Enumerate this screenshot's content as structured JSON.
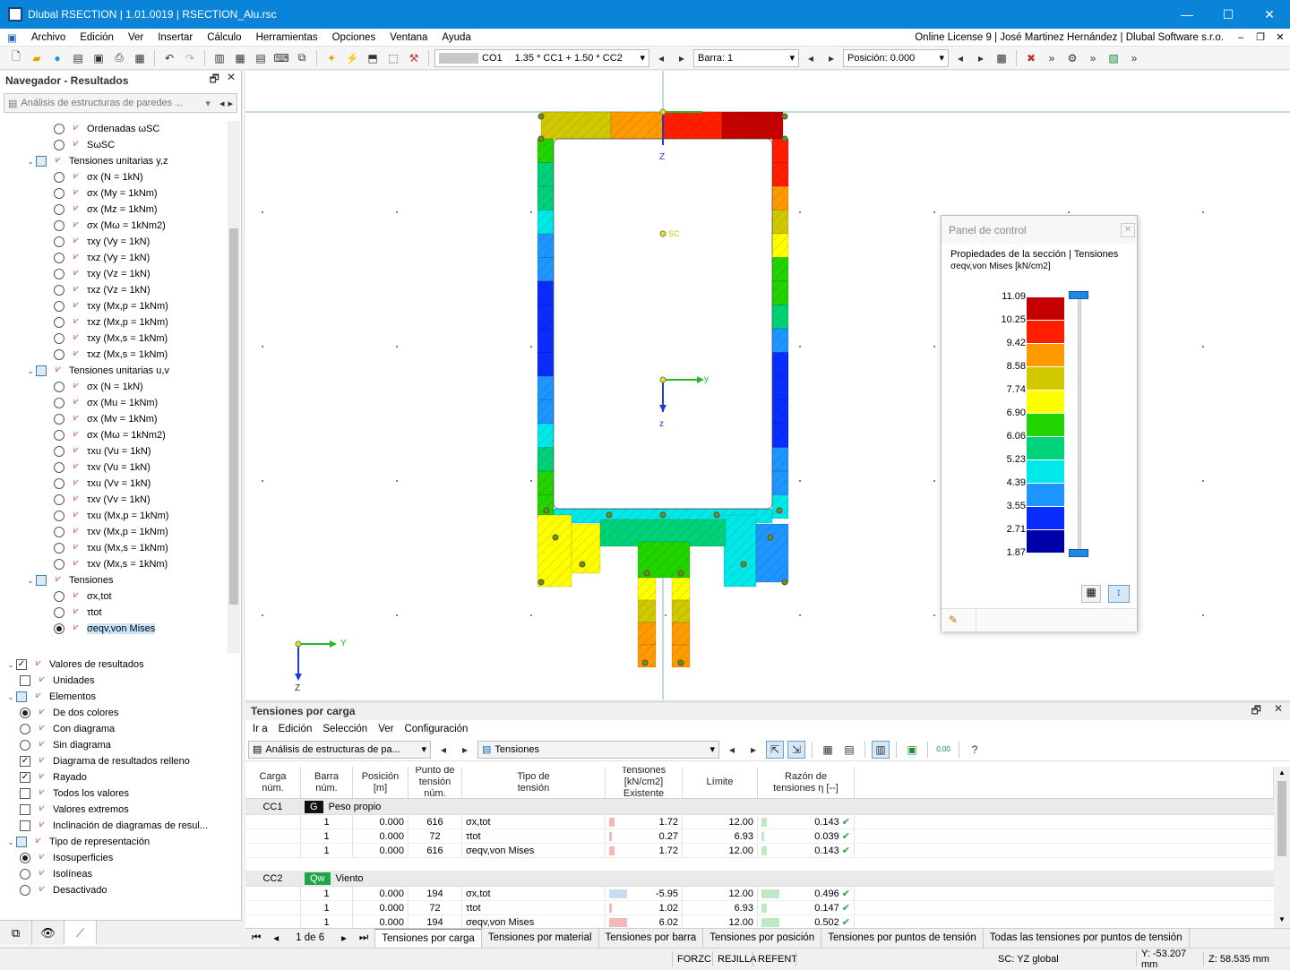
{
  "titlebar": {
    "title": "Dlubal RSECTION | 1.01.0019 | RSECTION_Alu.rsc",
    "minimize": "—",
    "maximize": "☐",
    "close": "✕"
  },
  "menu": {
    "items": [
      "Archivo",
      "Edición",
      "Ver",
      "Insertar",
      "Cálculo",
      "Herramientas",
      "Opciones",
      "Ventana",
      "Ayuda"
    ],
    "license": "Online License 9 | José Martinez Hernández | Dlubal Software s.r.o."
  },
  "toolbar": {
    "load_case": "CO1",
    "combination": "1.35 * CC1 + 1.50 * CC2",
    "member": "Barra: 1",
    "position": "Posición: 0.000"
  },
  "navigator": {
    "title": "Navegador - Resultados",
    "combo": "Análisis de estructuras de paredes ...",
    "tree": [
      {
        "lvl": 3,
        "type": "radio",
        "on": false,
        "label": "Ordenadas ωSC"
      },
      {
        "lvl": 3,
        "type": "radio",
        "on": false,
        "label": "SωSC"
      },
      {
        "lvl": 1,
        "type": "group",
        "label": "Tensiones unitarias y,z"
      },
      {
        "lvl": 3,
        "type": "radio",
        "on": false,
        "label": "σx (N = 1kN)"
      },
      {
        "lvl": 3,
        "type": "radio",
        "on": false,
        "label": "σx (My = 1kNm)"
      },
      {
        "lvl": 3,
        "type": "radio",
        "on": false,
        "label": "σx (Mz = 1kNm)"
      },
      {
        "lvl": 3,
        "type": "radio",
        "on": false,
        "label": "σx (Mω = 1kNm2)"
      },
      {
        "lvl": 3,
        "type": "radio",
        "on": false,
        "label": "τxy (Vy = 1kN)"
      },
      {
        "lvl": 3,
        "type": "radio",
        "on": false,
        "label": "τxz (Vy = 1kN)"
      },
      {
        "lvl": 3,
        "type": "radio",
        "on": false,
        "label": "τxy (Vz = 1kN)"
      },
      {
        "lvl": 3,
        "type": "radio",
        "on": false,
        "label": "τxz (Vz = 1kN)"
      },
      {
        "lvl": 3,
        "type": "radio",
        "on": false,
        "label": "τxy (Mx,p = 1kNm)"
      },
      {
        "lvl": 3,
        "type": "radio",
        "on": false,
        "label": "τxz (Mx,p = 1kNm)"
      },
      {
        "lvl": 3,
        "type": "radio",
        "on": false,
        "label": "τxy (Mx,s = 1kNm)"
      },
      {
        "lvl": 3,
        "type": "radio",
        "on": false,
        "label": "τxz (Mx,s = 1kNm)"
      },
      {
        "lvl": 1,
        "type": "group",
        "label": "Tensiones unitarias u,v"
      },
      {
        "lvl": 3,
        "type": "radio",
        "on": false,
        "label": "σx (N = 1kN)"
      },
      {
        "lvl": 3,
        "type": "radio",
        "on": false,
        "label": "σx (Mu = 1kNm)"
      },
      {
        "lvl": 3,
        "type": "radio",
        "on": false,
        "label": "σx (Mv = 1kNm)"
      },
      {
        "lvl": 3,
        "type": "radio",
        "on": false,
        "label": "σx (Mω = 1kNm2)"
      },
      {
        "lvl": 3,
        "type": "radio",
        "on": false,
        "label": "τxu (Vu = 1kN)"
      },
      {
        "lvl": 3,
        "type": "radio",
        "on": false,
        "label": "τxv (Vu = 1kN)"
      },
      {
        "lvl": 3,
        "type": "radio",
        "on": false,
        "label": "τxu (Vv = 1kN)"
      },
      {
        "lvl": 3,
        "type": "radio",
        "on": false,
        "label": "τxv (Vv = 1kN)"
      },
      {
        "lvl": 3,
        "type": "radio",
        "on": false,
        "label": "τxu (Mx,p = 1kNm)"
      },
      {
        "lvl": 3,
        "type": "radio",
        "on": false,
        "label": "τxv (Mx,p = 1kNm)"
      },
      {
        "lvl": 3,
        "type": "radio",
        "on": false,
        "label": "τxu (Mx,s = 1kNm)"
      },
      {
        "lvl": 3,
        "type": "radio",
        "on": false,
        "label": "τxv (Mx,s = 1kNm)"
      },
      {
        "lvl": 1,
        "type": "group",
        "label": "Tensiones"
      },
      {
        "lvl": 3,
        "type": "radio",
        "on": false,
        "label": "σx,tot"
      },
      {
        "lvl": 3,
        "type": "radio",
        "on": false,
        "label": "τtot"
      },
      {
        "lvl": 3,
        "type": "radio",
        "on": true,
        "label": "σeqv,von Mises",
        "sel": true
      }
    ],
    "tree2": [
      {
        "lvl": 0,
        "type": "check",
        "on": true,
        "label": "Valores de resultados",
        "exp": true
      },
      {
        "lvl": 1,
        "type": "check",
        "on": false,
        "label": "Unidades"
      },
      {
        "lvl": 0,
        "type": "sq",
        "label": "Elementos",
        "exp": true
      },
      {
        "lvl": 1,
        "type": "radio",
        "on": true,
        "label": "De dos colores"
      },
      {
        "lvl": 1,
        "type": "radio",
        "on": false,
        "label": "Con diagrama"
      },
      {
        "lvl": 1,
        "type": "radio",
        "on": false,
        "label": "Sin diagrama"
      },
      {
        "lvl": 1,
        "type": "check",
        "on": true,
        "label": "Diagrama de resultados relleno"
      },
      {
        "lvl": 1,
        "type": "check",
        "on": true,
        "label": "Rayado"
      },
      {
        "lvl": 1,
        "type": "check",
        "on": false,
        "label": "Todos los valores"
      },
      {
        "lvl": 1,
        "type": "check",
        "on": false,
        "label": "Valores extremos"
      },
      {
        "lvl": 1,
        "type": "check",
        "on": false,
        "label": "Inclinación de diagramas de resul..."
      },
      {
        "lvl": 0,
        "type": "sq",
        "label": "Tipo de representación",
        "exp": true
      },
      {
        "lvl": 1,
        "type": "radio",
        "on": true,
        "label": "Isosuperficies"
      },
      {
        "lvl": 1,
        "type": "radio",
        "on": false,
        "label": "Isolíneas"
      },
      {
        "lvl": 1,
        "type": "radio",
        "on": false,
        "label": "Desactivado"
      }
    ]
  },
  "viewport": {
    "axis_y": "y",
    "axis_z": "z",
    "axis_Y": "Y",
    "axis_Z": "Z",
    "sc_label": "SC"
  },
  "control_panel": {
    "title": "Panel de control",
    "heading": "Propiedades de la sección | Tensiones",
    "unit_label": "σeqv,von Mises [kN/cm2]",
    "legend_values": [
      "11.09",
      "10.25",
      "9.42",
      "8.58",
      "7.74",
      "6.90",
      "6.06",
      "5.23",
      "4.39",
      "3.55",
      "2.71",
      "1.87"
    ],
    "legend_colors": [
      "#c40000",
      "#ff1e00",
      "#ff9a00",
      "#d2c800",
      "#ffff00",
      "#22d400",
      "#00d27a",
      "#00e8e8",
      "#1e96ff",
      "#0a2cff",
      "#0000a8"
    ]
  },
  "results": {
    "title": "Tensiones por carga",
    "menu": [
      "Ir a",
      "Edición",
      "Selección",
      "Ver",
      "Configuración"
    ],
    "combo1": "Análisis de estructuras de pa...",
    "combo2": "Tensiones",
    "headers": [
      [
        "Carga",
        "núm."
      ],
      [
        "Barra",
        "núm."
      ],
      [
        "Posición",
        "[m]"
      ],
      [
        "Punto de",
        "tensión núm."
      ],
      [
        "Tipo de",
        "tensión"
      ],
      [
        "Tensiones [kN/cm2]",
        "Existente"
      ],
      [
        "",
        "Límite"
      ],
      [
        "Razón de",
        "tensiones η [--]"
      ]
    ],
    "groups": [
      {
        "case": "CC1",
        "badge": "G",
        "badge_color": "#111",
        "badge_text": "#fff",
        "name": "Peso propio",
        "rows": [
          {
            "member": "1",
            "pos": "0.000",
            "point": "616",
            "type": "σx,tot",
            "existing": "1.72",
            "limit": "12.00",
            "ratio": "0.143"
          },
          {
            "member": "1",
            "pos": "0.000",
            "point": "72",
            "type": "τtot",
            "existing": "0.27",
            "limit": "6.93",
            "ratio": "0.039"
          },
          {
            "member": "1",
            "pos": "0.000",
            "point": "616",
            "type": "σeqv,von Mises",
            "existing": "1.72",
            "limit": "12.00",
            "ratio": "0.143"
          }
        ]
      },
      {
        "case": "CC2",
        "badge": "Qw",
        "badge_color": "#1ea64a",
        "badge_text": "#fff",
        "name": "Viento",
        "rows": [
          {
            "member": "1",
            "pos": "0.000",
            "point": "194",
            "type": "σx,tot",
            "existing": "-5.95",
            "limit": "12.00",
            "ratio": "0.496"
          },
          {
            "member": "1",
            "pos": "0.000",
            "point": "72",
            "type": "τtot",
            "existing": "1.02",
            "limit": "6.93",
            "ratio": "0.147"
          },
          {
            "member": "1",
            "pos": "0.000",
            "point": "194",
            "type": "σeqv,von Mises",
            "existing": "6.02",
            "limit": "12.00",
            "ratio": "0.502"
          }
        ]
      }
    ],
    "pager": "1 de 6",
    "tabs": [
      "Tensiones por carga",
      "Tensiones por material",
      "Tensiones por barra",
      "Tensiones por posición",
      "Tensiones por puntos de tensión",
      "Todas las tensiones por puntos de tensión"
    ]
  },
  "status": {
    "snap": "FORZC",
    "grid": "REJILLA",
    "objsnap": "REFENT",
    "cs": "SC: YZ global",
    "y": "Y: -53.207 mm",
    "z": "Z: 58.535 mm"
  }
}
